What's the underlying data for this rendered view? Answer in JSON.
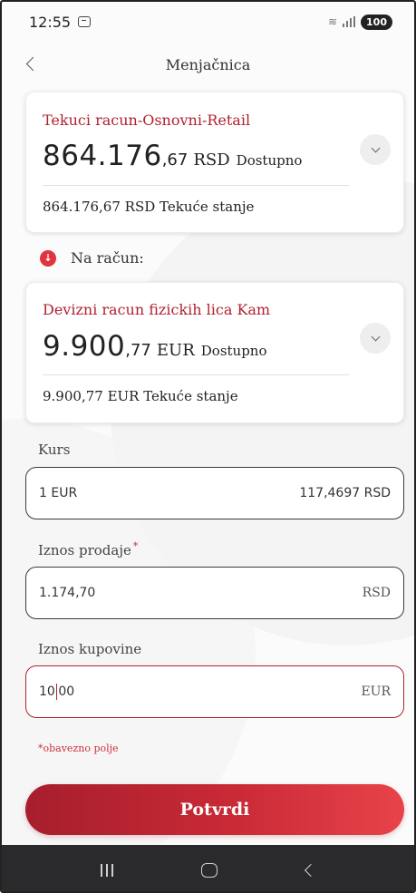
{
  "status_bar": {
    "time": "12:55",
    "battery": "100",
    "icons": [
      "screenshot-icon",
      "wifi-icon",
      "signal-icon",
      "battery-icon"
    ]
  },
  "header": {
    "title": "Menjačnica",
    "back_icon": "chevron-left-icon"
  },
  "from_account": {
    "name": "Tekuci racun-Osnovni-Retail",
    "amount_int": "864.176",
    "amount_dec": ",67",
    "currency": "RSD",
    "available_label": "Dostupno",
    "balance_text": "864.176,67 RSD Tekuće stanje"
  },
  "to_section": {
    "label": "Na račun:",
    "icon": "arrow-down-icon"
  },
  "to_account": {
    "name": "Devizni racun fizickih lica Kam",
    "amount_int": "9.900",
    "amount_dec": ",77",
    "currency": "EUR",
    "available_label": "Dostupno",
    "balance_text": "9.900,77 EUR Tekuće stanje"
  },
  "rate": {
    "label": "Kurs",
    "left": "1 EUR",
    "right": "117,4697 RSD"
  },
  "sell": {
    "label": "Iznos prodaje",
    "required_mark": "*",
    "value": "1.174,70",
    "currency": "RSD"
  },
  "buy": {
    "label": "Iznos kupovine",
    "value_before_caret": "10",
    "value_after_caret": "00",
    "currency": "EUR"
  },
  "required_note": "*obavezno polje",
  "confirm_button": "Potvrdi",
  "colors": {
    "brand_red": "#b0212f",
    "button_gradient_start": "#a71e2c",
    "button_gradient_end": "#e8434a",
    "nav_bar": "#2a2a2c"
  }
}
